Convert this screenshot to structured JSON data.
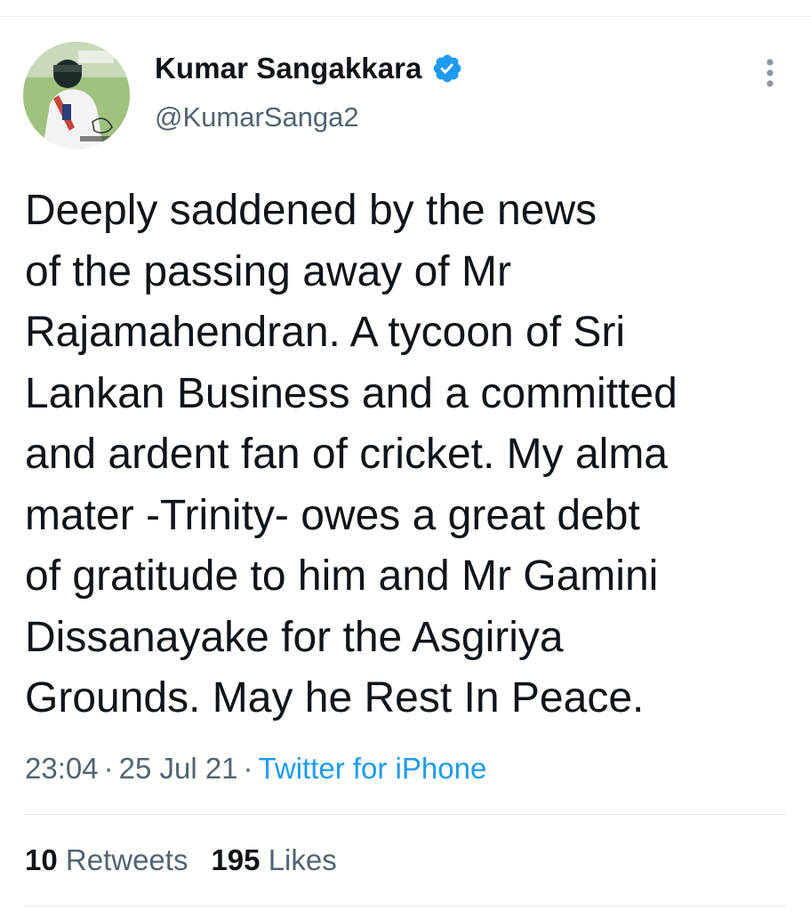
{
  "tweet": {
    "author": {
      "display_name": "Kumar Sangakkara",
      "handle": "@KumarSanga2",
      "verified_icon": "verified-badge-icon"
    },
    "text_lines": [
      "Deeply saddened by the news",
      "of the passing away of Mr",
      "Rajamahendran. A tycoon of Sri",
      "Lankan Business and a committed",
      "and ardent fan of cricket. My alma",
      "mater -Trinity- owes a great debt",
      "of gratitude to him and Mr Gamini",
      "Dissanayake for the Asgiriya",
      "Grounds. May he Rest In Peace."
    ],
    "time": "23:04",
    "date": "25 Jul 21",
    "separator": "·",
    "source": "Twitter for iPhone",
    "stats": {
      "retweets_count": "10",
      "retweets_label": "Retweets",
      "likes_count": "195",
      "likes_label": "Likes"
    },
    "more_icon": "more-options-icon"
  },
  "colors": {
    "accent": "#1d9bf0",
    "secondary_text": "#536471",
    "primary_text": "#0f1419",
    "divider": "#dfe5e8"
  }
}
